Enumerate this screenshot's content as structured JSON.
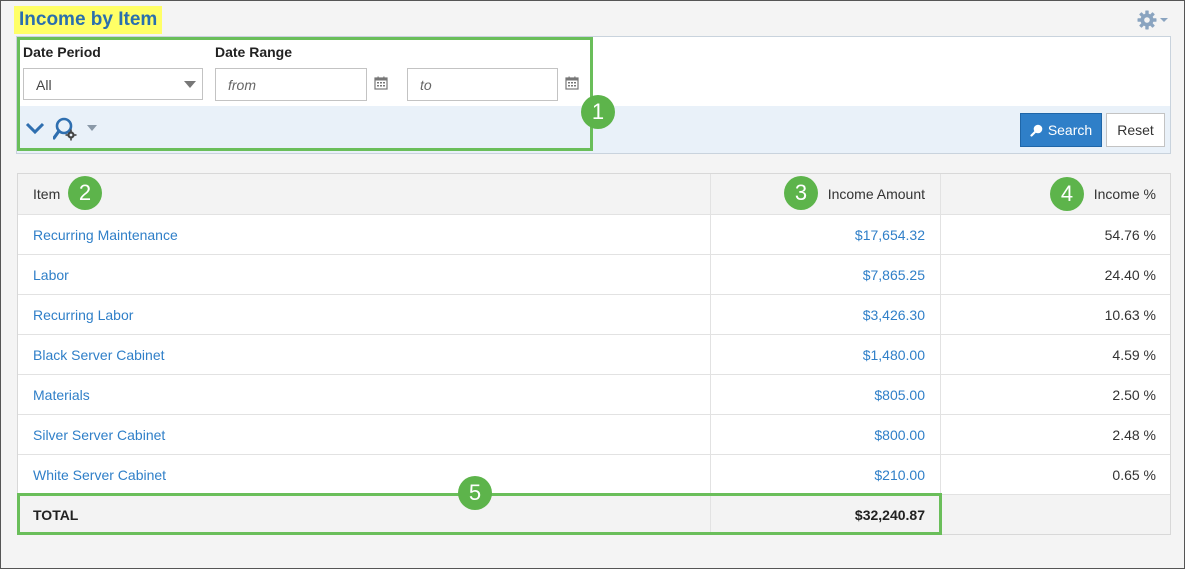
{
  "page": {
    "title": "Income by Item"
  },
  "filters": {
    "date_period_label": "Date Period",
    "date_period_value": "All",
    "date_range_label": "Date Range",
    "from_placeholder": "from",
    "to_placeholder": "to"
  },
  "buttons": {
    "search": "Search",
    "reset": "Reset"
  },
  "callouts": [
    "1",
    "2",
    "3",
    "4",
    "5"
  ],
  "table": {
    "headers": {
      "item": "Item",
      "amount": "Income Amount",
      "percent": "Income %"
    },
    "rows": [
      {
        "item": "Recurring Maintenance",
        "amount": "$17,654.32",
        "percent": "54.76 %"
      },
      {
        "item": "Labor",
        "amount": "$7,865.25",
        "percent": "24.40 %"
      },
      {
        "item": "Recurring Labor",
        "amount": "$3,426.30",
        "percent": "10.63 %"
      },
      {
        "item": "Black Server Cabinet",
        "amount": "$1,480.00",
        "percent": "4.59 %"
      },
      {
        "item": "Materials",
        "amount": "$805.00",
        "percent": "2.50 %"
      },
      {
        "item": "Silver Server Cabinet",
        "amount": "$800.00",
        "percent": "2.48 %"
      },
      {
        "item": "White Server Cabinet",
        "amount": "$210.00",
        "percent": "0.65 %"
      }
    ],
    "total": {
      "label": "TOTAL",
      "amount": "$32,240.87"
    }
  },
  "colors": {
    "accent": "#2f7fc8",
    "highlight": "#ffff66",
    "callout": "#5db44b"
  }
}
